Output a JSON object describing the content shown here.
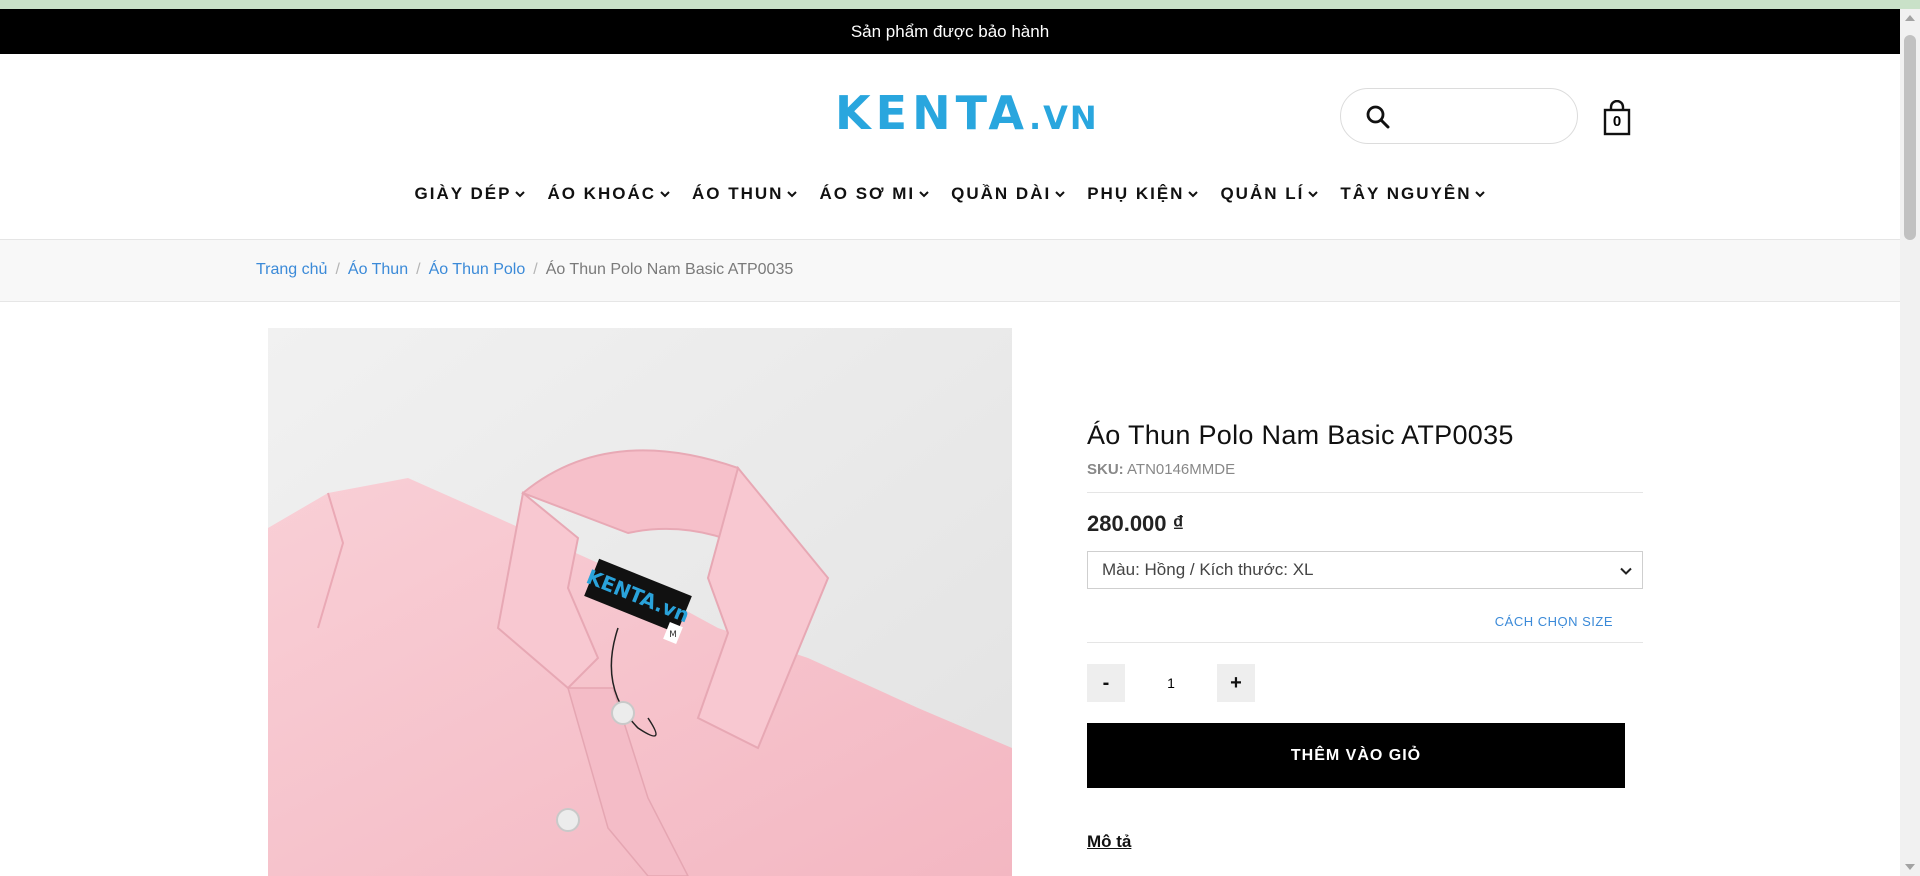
{
  "announcement": "Sản phẩm được bảo hành",
  "logo": {
    "main": "KENTA",
    "suffix": ".VN"
  },
  "search": {
    "placeholder": "",
    "value": ""
  },
  "cart": {
    "count": "0"
  },
  "nav": [
    {
      "label": "GIÀY DÉP"
    },
    {
      "label": "ÁO KHOÁC"
    },
    {
      "label": "ÁO THUN"
    },
    {
      "label": "ÁO SƠ MI"
    },
    {
      "label": "QUẦN DÀI"
    },
    {
      "label": "PHỤ KIỆN"
    },
    {
      "label": "QUẢN LÍ"
    },
    {
      "label": "TÂY NGUYÊN"
    }
  ],
  "breadcrumb": {
    "home": "Trang chủ",
    "level1": "Áo Thun",
    "level2": "Áo Thun Polo",
    "current": "Áo Thun Polo Nam Basic ATP0035",
    "separator": "/"
  },
  "product": {
    "title": "Áo Thun Polo Nam Basic ATP0035",
    "sku_label": "SKU:",
    "sku_value": "ATN0146MMDE",
    "price": "280.000 ₫",
    "variant_selected": "Màu: Hồng / Kích thước: XL",
    "size_guide": "CÁCH CHỌN SIZE",
    "qty_minus": "-",
    "qty_value": "1",
    "qty_plus": "+",
    "add_to_cart": "THÊM VÀO GIỎ",
    "description_label": "Mô tả",
    "image_label_brand": "KENTA.vn",
    "image_label_size": "M"
  },
  "colors": {
    "brand": "#29a6de",
    "link": "#3b8ad8",
    "shirt": "#f7c6cf"
  }
}
